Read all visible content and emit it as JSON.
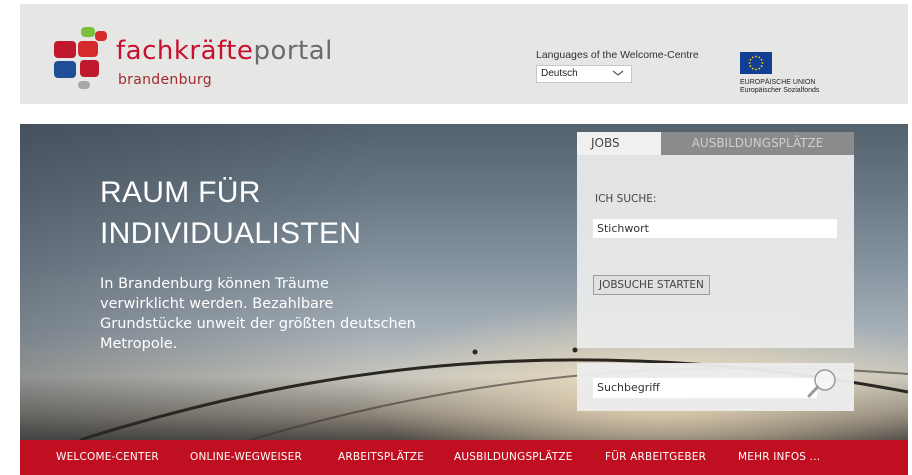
{
  "header": {
    "logo": {
      "main_prefix": "fachkräfte",
      "main_suffix": "portal",
      "sub": "brandenburg"
    },
    "language": {
      "label": "Languages of the Welcome-Centre",
      "selected": "Deutsch"
    },
    "eu": {
      "line1": "EUROPÄISCHE UNION",
      "line2": "Europäischer Sozialfonds"
    }
  },
  "hero": {
    "title_line1": "RAUM FÜR",
    "title_line2": "INDIVIDUALISTEN",
    "text_lines": [
      "In Brandenburg können Träume",
      "verwirklicht werden. Bezahlbare",
      "Grundstücke unweit der größten deutschen",
      "Metropole."
    ]
  },
  "search_panel": {
    "tabs": [
      {
        "label": "JOBS",
        "active": true
      },
      {
        "label": "AUSBILDUNGSPLÄTZE",
        "active": false
      }
    ],
    "label": "ICH SUCHE:",
    "keyword_placeholder": "Stichwort",
    "submit_label": "JOBSUCHE STARTEN"
  },
  "site_search": {
    "placeholder": "Suchbegriff"
  },
  "nav": {
    "items": [
      {
        "label": "WELCOME-CENTER"
      },
      {
        "label": "ONLINE-WEGWEISER"
      },
      {
        "label": "ARBEITSPLÄTZE"
      },
      {
        "label": "AUSBILDUNGSPLÄTZE"
      },
      {
        "label": "FÜR ARBEITGEBER"
      },
      {
        "label": "MEHR INFOS ..."
      }
    ]
  },
  "colors": {
    "brand_red": "#c00f20",
    "brand_blue": "#1f4e96",
    "logo_grey": "#6b6b6b"
  }
}
